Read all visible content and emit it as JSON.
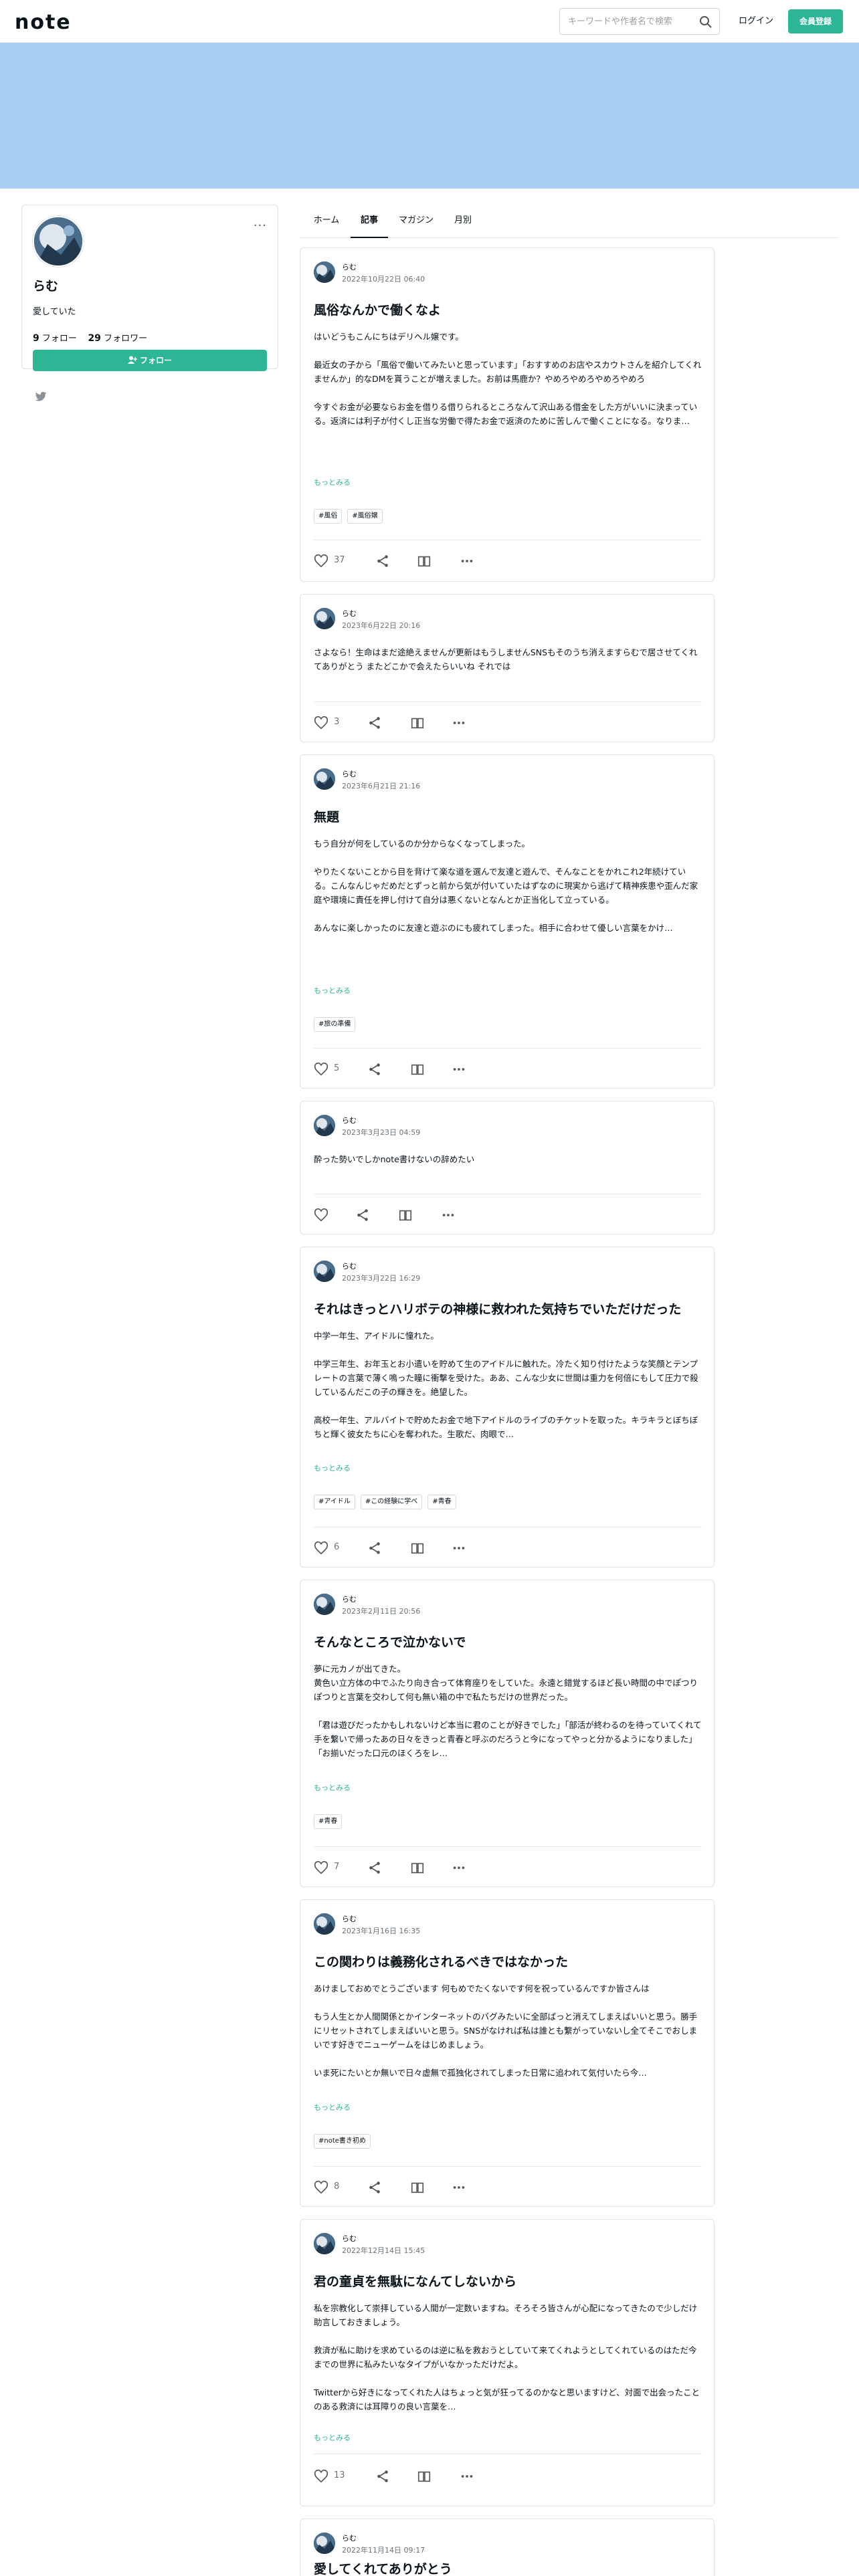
{
  "header": {
    "logo": "note",
    "search_placeholder": "キーワードや作者名で検索",
    "login": "ログイン",
    "signup": "会員登録"
  },
  "colors": {
    "brand": "#2cb696",
    "cover": "#a8cdf2"
  },
  "profile": {
    "name": "らむ",
    "bio": "愛していた",
    "following": "9",
    "following_label": "フォロー",
    "followers": "29",
    "followers_label": "フォロワー",
    "follow_button": "フォロー",
    "menu": "···"
  },
  "tabs": [
    "ホーム",
    "記事",
    "マガジン",
    "月別"
  ],
  "active_tab": "記事",
  "more_label": "もっとみる",
  "posts": [
    {
      "author": "らむ",
      "date": "2022年10月22日 06:40",
      "title": "風俗なんかで働くなよ",
      "body": "はいどうもこんにちはデリヘル嬢です。\n\n最近女の子から「風俗で働いてみたいと思っています」「おすすめのお店やスカウトさんを紹介してくれませんか」的なDMを貰うことが増えました。お前は馬鹿か？やめろやめろやめろやめろ\n\n今すぐお金が必要ならお金を借りる借りられるところなんて沢山ある借金をした方がいいに決まっている。返済には利子が付くし正当な労働で得たお金で返済のために苦しんで働くことになる。なりま…",
      "tags": [
        "#風俗",
        "#風俗嬢"
      ],
      "likes": "37"
    },
    {
      "author": "らむ",
      "date": "2023年6月22日 20:16",
      "title": "",
      "body": "さよなら！生命はまだ途絶えませんが更新はもうしませんSNSもそのうち消えますらむで居させてくれてありがとう またどこかで会えたらいいね それでは",
      "tags": [],
      "likes": "3"
    },
    {
      "author": "らむ",
      "date": "2023年6月21日 21:16",
      "title": "無題",
      "body": "もう自分が何をしているのか分からなくなってしまった。\n\nやりたくないことから目を背けて楽な道を選んで友達と遊んで、そんなことをかれこれ2年続けている。こんなんじゃだめだとずっと前から気が付いていたはずなのに現実から逃げて精神疾患や歪んだ家庭や環境に責任を押し付けて自分は悪くないとなんとか正当化して立っている。\n\nあんなに楽しかったのに友達と遊ぶのにも疲れてしまった。相手に合わせて優しい言葉をかけ…",
      "tags": [
        "#旅の準備"
      ],
      "likes": "5"
    },
    {
      "author": "らむ",
      "date": "2023年3月23日 04:59",
      "title": "",
      "body": "酔った勢いでしかnote書けないの辞めたい",
      "tags": [],
      "likes": ""
    },
    {
      "author": "らむ",
      "date": "2023年3月22日 16:29",
      "title": "それはきっとハリボテの神様に救われた気持ちでいただけだった",
      "body": "中学一年生、アイドルに憧れた。\n\n中学三年生、お年玉とお小遣いを貯めて生のアイドルに触れた。冷たく知り付けたような笑顔とテンプレートの言葉で薄く鳴った瞳に衝撃を受けた。ああ、こんな少女に世間は重力を何倍にもして圧力で殺しているんだこの子の輝きを。絶望した。\n\n高校一年生、アルバイトで貯めたお金で地下アイドルのライブのチケットを取った。キラキラとぼちぼちと輝く彼女たちに心を奪われた。生歌だ、肉眼で…",
      "tags": [
        "#アイドル",
        "#この経験に学べ",
        "#青春"
      ],
      "likes": "6"
    },
    {
      "author": "らむ",
      "date": "2023年2月11日 20:56",
      "title": "そんなところで泣かないで",
      "body": "夢に元カノが出てきた。\n黄色い立方体の中でふたり向き合って体育座りをしていた。永遠と錯覚するほど長い時間の中でぽつりぽつりと言葉を交わして何も無い箱の中で私たちだけの世界だった。\n\n「君は遊びだったかもしれないけど本当に君のことが好きでした」「部活が終わるのを待っていてくれて手を繋いで帰ったあの日々をきっと青春と呼ぶのだろうと今になってやっと分かるようになりました」「お揃いだった口元のほくろをレ…",
      "tags": [
        "#青春"
      ],
      "likes": "7"
    },
    {
      "author": "らむ",
      "date": "2023年1月16日 16:35",
      "title": "この関わりは義務化されるべきではなかった",
      "body": "あけましておめでとうございます 何もめでたくないです何を祝っているんですか皆さんは\n\nもう人生とか人間関係とかインターネットのバグみたいに全部ぱっと消えてしまえばいいと思う。勝手にリセットされてしまえばいいと思う。SNSがなければ私は誰とも繋がっていないし全てそこでおしまいです好きでニューゲームをはじめましょう。\n\nいま死にたいとか無いで日々虚無で孤独化されてしまった日常に追われて気付いたら今…",
      "tags": [
        "#note書き初め"
      ],
      "likes": "8"
    },
    {
      "author": "らむ",
      "date": "2022年12月14日 15:45",
      "title": "君の童貞を無駄になんてしないから",
      "body": "私を宗教化して崇拝している人間が一定数いますね。そろそろ皆さんが心配になってきたので少しだけ助言しておきましょう。\n\n救済が私に助けを求めているのは逆に私を救おうとしていて来てくれようとしてくれているのはただ今までの世界に私みたいなタイプがいなかっただけだよ。\n\nTwitterから好きになってくれた人はちょっと気が狂ってるのかなと思いますけど、対面で出会ったことのある救済には耳障りの良い言葉を…",
      "tags": [],
      "likes": "13"
    },
    {
      "author": "らむ",
      "date": "2022年11月14日 09:17",
      "title": "愛してくれてありがとう",
      "body": "",
      "tags": [],
      "likes": ""
    }
  ]
}
